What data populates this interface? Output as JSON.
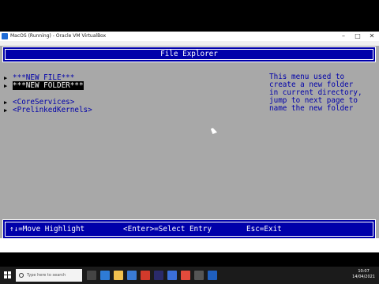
{
  "window": {
    "title": "MacOS (Running) - Oracle VM VirtualBox",
    "controls": [
      "–",
      "□",
      "✕"
    ]
  },
  "efi": {
    "header_title": "File Explorer",
    "entries": [
      {
        "label": "***NEW FILE***",
        "selected": false
      },
      {
        "label": "***NEW FOLDER***",
        "selected": true
      },
      {
        "label": "<CoreServices>",
        "selected": false
      },
      {
        "label": "<PrelinkedKernels>",
        "selected": false
      }
    ],
    "help_text": "This menu used to\ncreate a new folder\nin current directory,\njump to next page to\nname the new folder",
    "footer": {
      "move": "↑↓=Move Highlight",
      "select": "<Enter>=Select Entry",
      "exit": "Esc=Exit"
    }
  },
  "taskbar": {
    "search_placeholder": "Type here to search",
    "time": "10:07",
    "date": "14/04/2021"
  },
  "colors": {
    "efi_blue": "#0000aa",
    "efi_gray": "#a8a8a8",
    "highlight": "#000000"
  }
}
